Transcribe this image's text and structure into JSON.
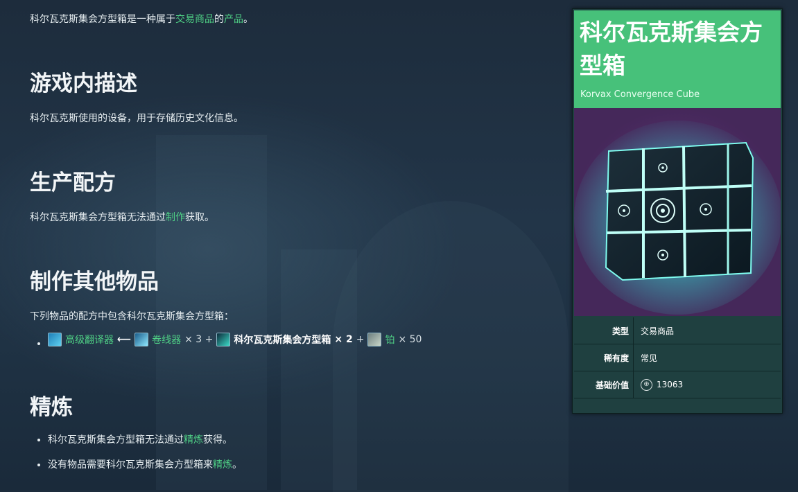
{
  "intro": {
    "prefix": "科尔瓦克斯集会方型箱是一种属于",
    "link1": "交易商品",
    "middle": "的",
    "link2": "产品",
    "suffix": "。"
  },
  "sections": {
    "description": {
      "title": "游戏内描述",
      "text": "科尔瓦克斯使用的设备，用于存储历史文化信息。"
    },
    "production": {
      "title": "生产配方",
      "prefix": "科尔瓦克斯集会方型箱无法通过",
      "link": "制作",
      "suffix": "获取。"
    },
    "crafting": {
      "title": "制作其他物品",
      "intro": "下列物品的配方中包含科尔瓦克斯集会方型箱：",
      "recipe": {
        "result": "高级翻译器",
        "arrow": "⟵",
        "ingredient1": "卷线器",
        "qty1": "× 3 +",
        "ingredient2": "科尔瓦克斯集会方型箱",
        "qty2": "× 2",
        "plus2": "+",
        "ingredient3": "铂",
        "qty3": "× 50"
      }
    },
    "refining": {
      "title": "精炼",
      "item1_prefix": "科尔瓦克斯集会方型箱无法通过",
      "item1_link": "精炼",
      "item1_suffix": "获得。",
      "item2_prefix": "没有物品需要科尔瓦克斯集会方型箱来",
      "item2_link": "精炼",
      "item2_suffix": "。"
    }
  },
  "infobox": {
    "title": "科尔瓦克斯集会方型箱",
    "subtitle": "Korvax Convergence Cube",
    "rows": [
      {
        "label": "类型",
        "value": "交易商品"
      },
      {
        "label": "稀有度",
        "value": "常见"
      },
      {
        "label": "基础价值",
        "value": "13063"
      }
    ],
    "currency_icon": "units-icon",
    "header_color": "#47c17a"
  },
  "colors": {
    "link": "#4fd085",
    "infobox_bg": "#1f4040"
  }
}
